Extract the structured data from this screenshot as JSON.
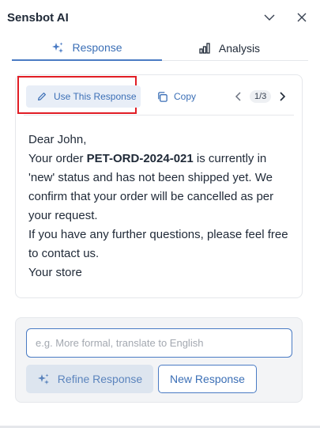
{
  "header": {
    "title": "Sensbot AI",
    "collapse_icon": "chevron-down-icon",
    "close_icon": "close-icon"
  },
  "tabs": [
    {
      "label": "Response",
      "icon": "sparkle-icon",
      "active": true
    },
    {
      "label": "Analysis",
      "icon": "bar-chart-icon",
      "active": false
    }
  ],
  "card": {
    "use_label": "Use This Response",
    "copy_label": "Copy",
    "page": "1/3",
    "message": {
      "greeting": "Dear John,",
      "line1_pre": "Your order ",
      "order_id": "PET-ORD-2024-021",
      "line1_post": " is currently in 'new' status and has not been shipped yet. We confirm that your order will be cancelled as per your request.",
      "line2": "If you have any further questions, please feel free to contact us.",
      "signoff": "Your store"
    }
  },
  "refine": {
    "placeholder": "e.g. More formal, translate to English",
    "value": "",
    "refine_label": "Refine Response",
    "new_label": "New Response"
  },
  "colors": {
    "accent": "#3b6fb6",
    "highlight": "#e11d25"
  }
}
